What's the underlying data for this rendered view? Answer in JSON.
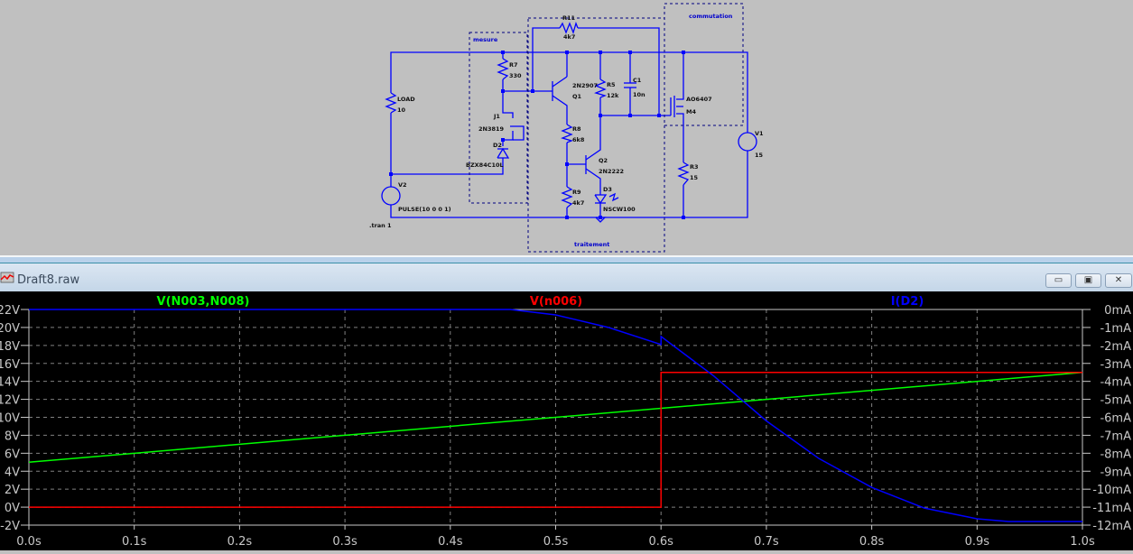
{
  "schematic": {
    "groups": {
      "mesure": "mesure",
      "traitement": "traitement",
      "commutation": "commutation"
    },
    "components": {
      "load": {
        "name": "LOAD",
        "value": "10"
      },
      "v2": {
        "name": "V2",
        "value": "PULSE(10 0 0 1)"
      },
      "r7": {
        "name": "R7",
        "value": "330"
      },
      "j1": {
        "name": "J1",
        "value": "2N3819"
      },
      "d2": {
        "name": "D2",
        "value": "BZX84C10L"
      },
      "r11": {
        "name": "R11",
        "value": "4k7"
      },
      "q1": {
        "name": "Q1",
        "value": "2N2907"
      },
      "r5": {
        "name": "R5",
        "value": "12k"
      },
      "c1": {
        "name": "C1",
        "value": "10n"
      },
      "r8": {
        "name": "R8",
        "value": "6k8"
      },
      "q2": {
        "name": "Q2",
        "value": "2N2222"
      },
      "r9": {
        "name": "R9",
        "value": "4k7"
      },
      "d3": {
        "name": "D3",
        "value": "NSCW100"
      },
      "m4": {
        "name": "M4",
        "value": "AO6407"
      },
      "r3": {
        "name": "R3",
        "value": "15"
      },
      "v1": {
        "name": "V1",
        "value": "15"
      }
    },
    "directive": ".tran 1",
    "wire_color": "#0000ff"
  },
  "plot_window": {
    "title": "Draft8.raw",
    "buttons": {
      "minimize": "▭",
      "restore": "▣",
      "close": "✕"
    }
  },
  "chart_data": {
    "type": "line",
    "traces": [
      {
        "name": "V(N003,N008)",
        "color": "#00ff00",
        "axis": "left",
        "x": [
          0,
          1.0
        ],
        "y": [
          5,
          15
        ]
      },
      {
        "name": "V(n006)",
        "color": "#ff0000",
        "axis": "left",
        "x": [
          0,
          0.6,
          0.6,
          1.0
        ],
        "y": [
          0,
          0,
          15,
          15
        ]
      },
      {
        "name": "I(D2)",
        "color": "#0000ff",
        "axis": "right",
        "x": [
          0,
          0.457,
          0.5,
          0.55,
          0.6,
          0.6,
          0.65,
          0.7,
          0.75,
          0.8,
          0.85,
          0.9,
          0.93,
          1.0
        ],
        "y": [
          0,
          0,
          -0.3,
          -1.0,
          -1.95,
          -1.5,
          -3.7,
          -6.2,
          -8.3,
          -9.9,
          -11.05,
          -11.65,
          -11.8,
          -11.8
        ]
      }
    ],
    "x_axis": {
      "range": [
        0,
        1.0
      ],
      "ticks": [
        "0.0s",
        "0.1s",
        "0.2s",
        "0.3s",
        "0.4s",
        "0.5s",
        "0.6s",
        "0.7s",
        "0.8s",
        "0.9s",
        "1.0s"
      ]
    },
    "left_axis": {
      "range": [
        -2,
        22
      ],
      "ticks": [
        "22V",
        "20V",
        "18V",
        "16V",
        "14V",
        "12V",
        "10V",
        "8V",
        "6V",
        "4V",
        "2V",
        "0V",
        "-2V"
      ]
    },
    "right_axis": {
      "range": [
        -12,
        0
      ],
      "ticks": [
        "0mA",
        "-1mA",
        "-2mA",
        "-3mA",
        "-4mA",
        "-5mA",
        "-6mA",
        "-7mA",
        "-8mA",
        "-9mA",
        "-10mA",
        "-11mA",
        "-12mA"
      ]
    },
    "grid": true,
    "background": "#000000"
  }
}
